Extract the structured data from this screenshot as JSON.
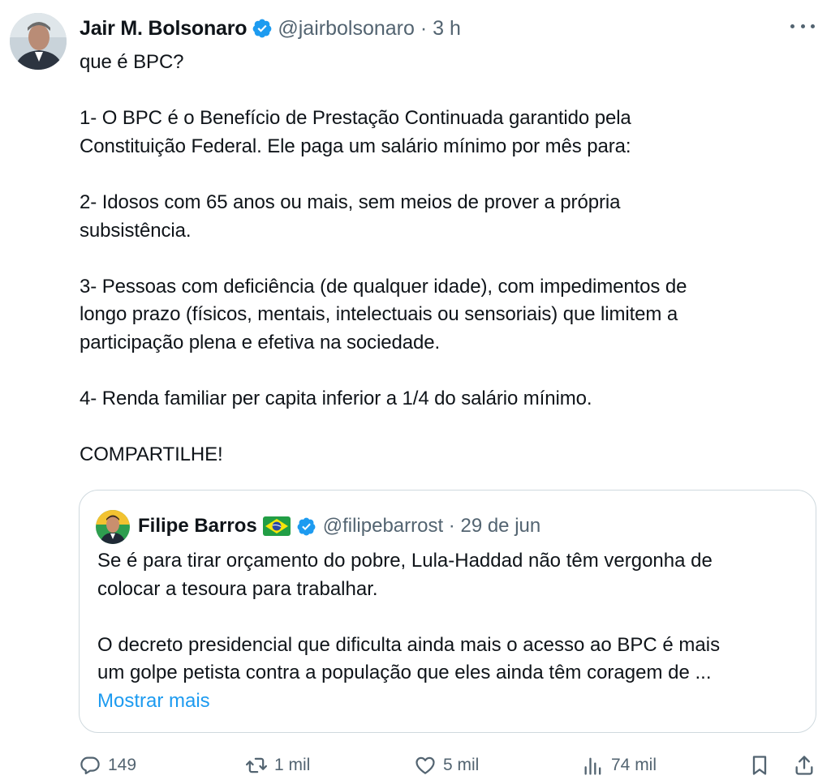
{
  "author": {
    "name": "Jair M. Bolsonaro",
    "handle": "@jairbolsonaro",
    "time": "3 h",
    "avatar_icon": "profile-photo",
    "verified_color": "#1d9bf0"
  },
  "tweet": {
    "text": "que é BPC?\n\n1- O BPC é o Benefício de Prestação Continuada garantido pela\nConstituição Federal. Ele paga um salário mínimo por mês para:\n\n2- Idosos com 65 anos ou mais, sem meios de prover a própria\nsubsistência.\n\n3- Pessoas com deficiência (de qualquer idade), com impedimentos de\nlongo prazo (físicos, mentais, intelectuais ou sensoriais) que limitem a\nparticipação plena e efetiva na sociedade.\n\n4- Renda familiar per capita inferior a 1/4 do salário mínimo.\n\nCOMPARTILHE!"
  },
  "quote": {
    "name": "Filipe Barros",
    "flag_icon": "brazil-flag",
    "handle": "@filipebarrost",
    "date": "29 de jun",
    "text": "Se é para tirar orçamento do pobre, Lula-Haddad não têm vergonha de\ncolocar a tesoura para trabalhar.\n\nO decreto presidencial que dificulta ainda mais o acesso ao BPC é mais\num golpe petista contra a população que eles ainda têm coragem de ...",
    "show_more": "Mostrar mais"
  },
  "actions": {
    "replies": "149",
    "retweets": "1 mil",
    "likes": "5 mil",
    "views": "74 mil"
  },
  "colors": {
    "text": "#0f1419",
    "secondary": "#536471",
    "link": "#1d9bf0",
    "border": "#cfd9de"
  }
}
